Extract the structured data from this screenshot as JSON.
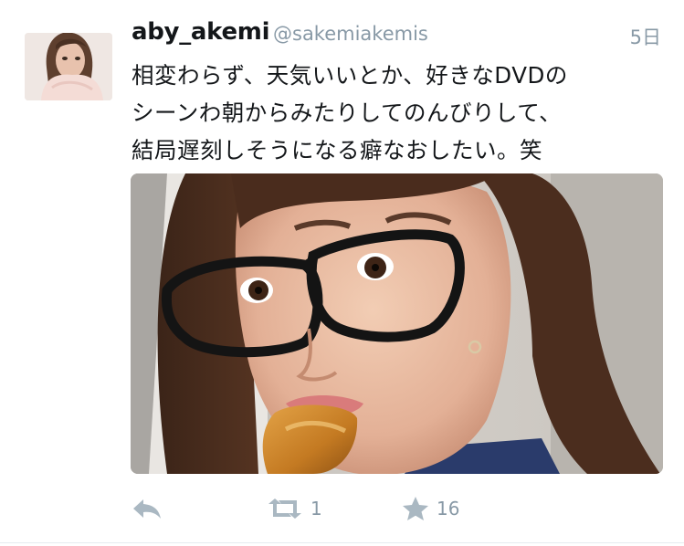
{
  "tweet": {
    "display_name": "aby_akemi",
    "handle": "@sakemiakemis",
    "time": "5日",
    "text_lines": [
      "相変わらず、天気いいとか、好きなDVDの",
      "シーンわ朝からみたりしてのんびりして、",
      "結局遅刻しそうになる癖なおしたい。笑"
    ],
    "media_description": "selfie of woman wearing black glasses biting bread"
  },
  "actions": {
    "reply_icon": "reply-icon",
    "retweet_icon": "retweet-icon",
    "retweet_count": "1",
    "like_icon": "star-icon",
    "like_count": "16"
  },
  "colors": {
    "text": "#14171a",
    "muted": "#8899a6",
    "icon": "#aab8c2"
  }
}
